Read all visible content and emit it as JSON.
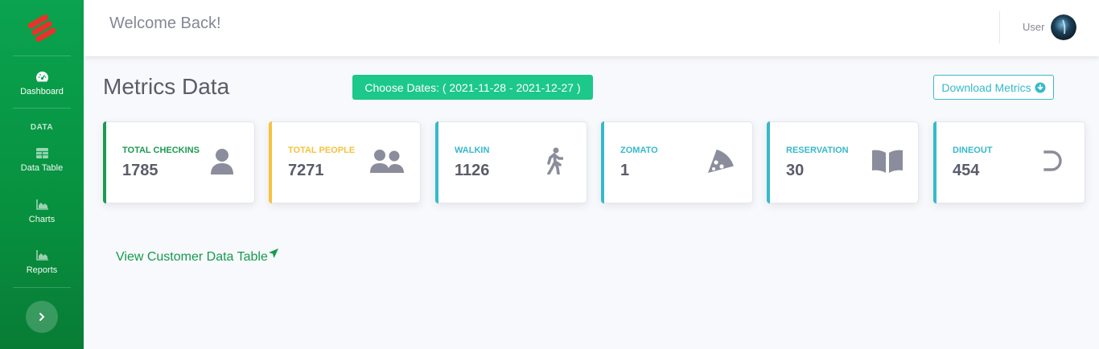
{
  "sidebar": {
    "items": [
      {
        "label": "Dashboard",
        "icon": "tachometer-icon"
      },
      {
        "label": "Data Table",
        "icon": "table-icon"
      },
      {
        "label": "Charts",
        "icon": "chart-area-icon"
      },
      {
        "label": "Reports",
        "icon": "chart-area-icon"
      }
    ],
    "heading": "DATA",
    "colors": {
      "bg": "#0aa34f",
      "logo": "#e8332a"
    }
  },
  "topbar": {
    "welcome": "Welcome Back!",
    "user_label": "User"
  },
  "main": {
    "title": "Metrics Data",
    "dates_button": "Choose Dates: ( 2021-11-28 - 2021-12-27 )",
    "download_button": "Download Metrics",
    "view_link": "View Customer Data Table"
  },
  "cards": [
    {
      "title": "TOTAL CHECKINS",
      "value": "1785",
      "color": "#1c9a52",
      "icon": "user-icon"
    },
    {
      "title": "TOTAL PEOPLE",
      "value": "7271",
      "color": "#f6c23e",
      "icon": "users-icon"
    },
    {
      "title": "WALKIN",
      "value": "1126",
      "color": "#36b9cc",
      "icon": "walking-icon"
    },
    {
      "title": "ZOMATO",
      "value": "1",
      "color": "#36b9cc",
      "icon": "pizza-icon"
    },
    {
      "title": "RESERVATION",
      "value": "30",
      "color": "#36b9cc",
      "icon": "book-open-icon"
    },
    {
      "title": "DINEOUT",
      "value": "454",
      "color": "#36b9cc",
      "icon": "dineout-icon"
    }
  ]
}
